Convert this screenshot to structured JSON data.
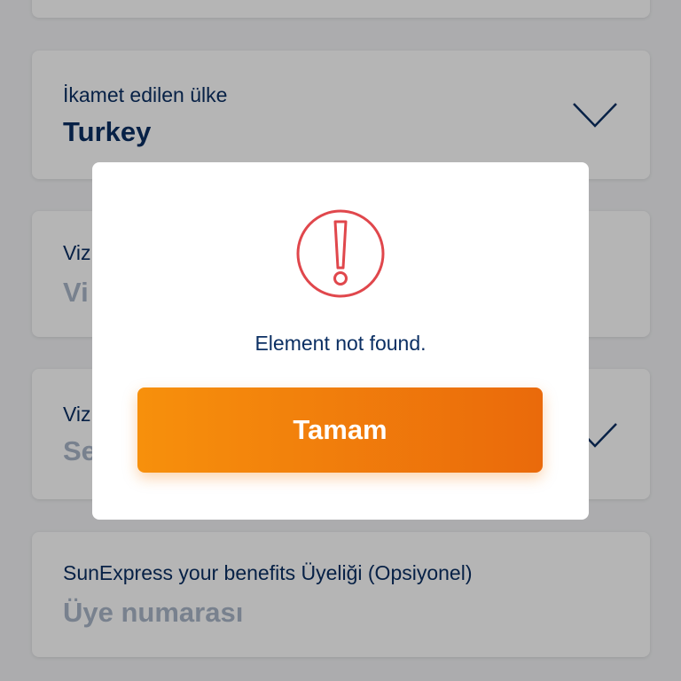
{
  "form": {
    "country_field": {
      "label": "İkamet edilen ülke",
      "value": "Turkey"
    },
    "visa_number_field": {
      "label": "Viz",
      "placeholder": "Vi"
    },
    "visa_type_field": {
      "label": "Viz",
      "placeholder": "Se"
    },
    "membership_field": {
      "label": "SunExpress your benefits Üyeliği (Opsiyonel)",
      "placeholder": "Üye numarası"
    }
  },
  "dialog": {
    "icon": "exclamation-circle-icon",
    "message": "Element not found.",
    "button_label": "Tamam"
  },
  "colors": {
    "text_primary": "#0b2f63",
    "placeholder": "#aab6c8",
    "alert_red": "#e0474c",
    "button_start": "#f7900c",
    "button_end": "#ea6a0b"
  }
}
